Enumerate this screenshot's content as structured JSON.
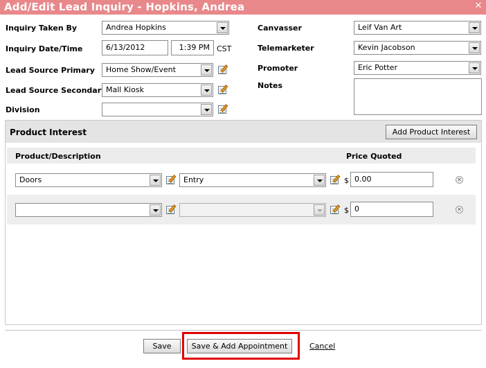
{
  "window": {
    "title": "Add/Edit Lead Inquiry - Hopkins, Andrea",
    "close_glyph": "✕"
  },
  "form": {
    "inquiry_taken_by": {
      "label": "Inquiry Taken By",
      "value": "Andrea Hopkins"
    },
    "inquiry_datetime": {
      "label": "Inquiry Date/Time",
      "date": "6/13/2012",
      "time": "1:39 PM",
      "tz": "CST"
    },
    "lead_source_primary": {
      "label": "Lead Source Primary",
      "value": "Home Show/Event"
    },
    "lead_source_secondary": {
      "label": "Lead Source Secondary",
      "value": "Mall Kiosk"
    },
    "division": {
      "label": "Division",
      "value": ""
    },
    "canvasser": {
      "label": "Canvasser",
      "value": "Leif Van Art"
    },
    "telemarketer": {
      "label": "Telemarketer",
      "value": "Kevin Jacobson"
    },
    "promoter": {
      "label": "Promoter",
      "value": "Eric Potter"
    },
    "notes": {
      "label": "Notes",
      "value": ""
    }
  },
  "product_interest": {
    "title": "Product Interest",
    "add_button": "Add Product Interest",
    "columns": {
      "product": "Product/Description",
      "price": "Price Quoted"
    },
    "currency": "$",
    "rows": [
      {
        "product": "Doors",
        "description": "Entry",
        "price": "0.00"
      },
      {
        "product": "",
        "description": "",
        "price": "0"
      }
    ]
  },
  "footer": {
    "save": "Save",
    "save_add_appointment": "Save & Add Appointment",
    "cancel": "Cancel"
  },
  "colors": {
    "titlebar": "#e8888b",
    "highlight": "#e00000"
  }
}
